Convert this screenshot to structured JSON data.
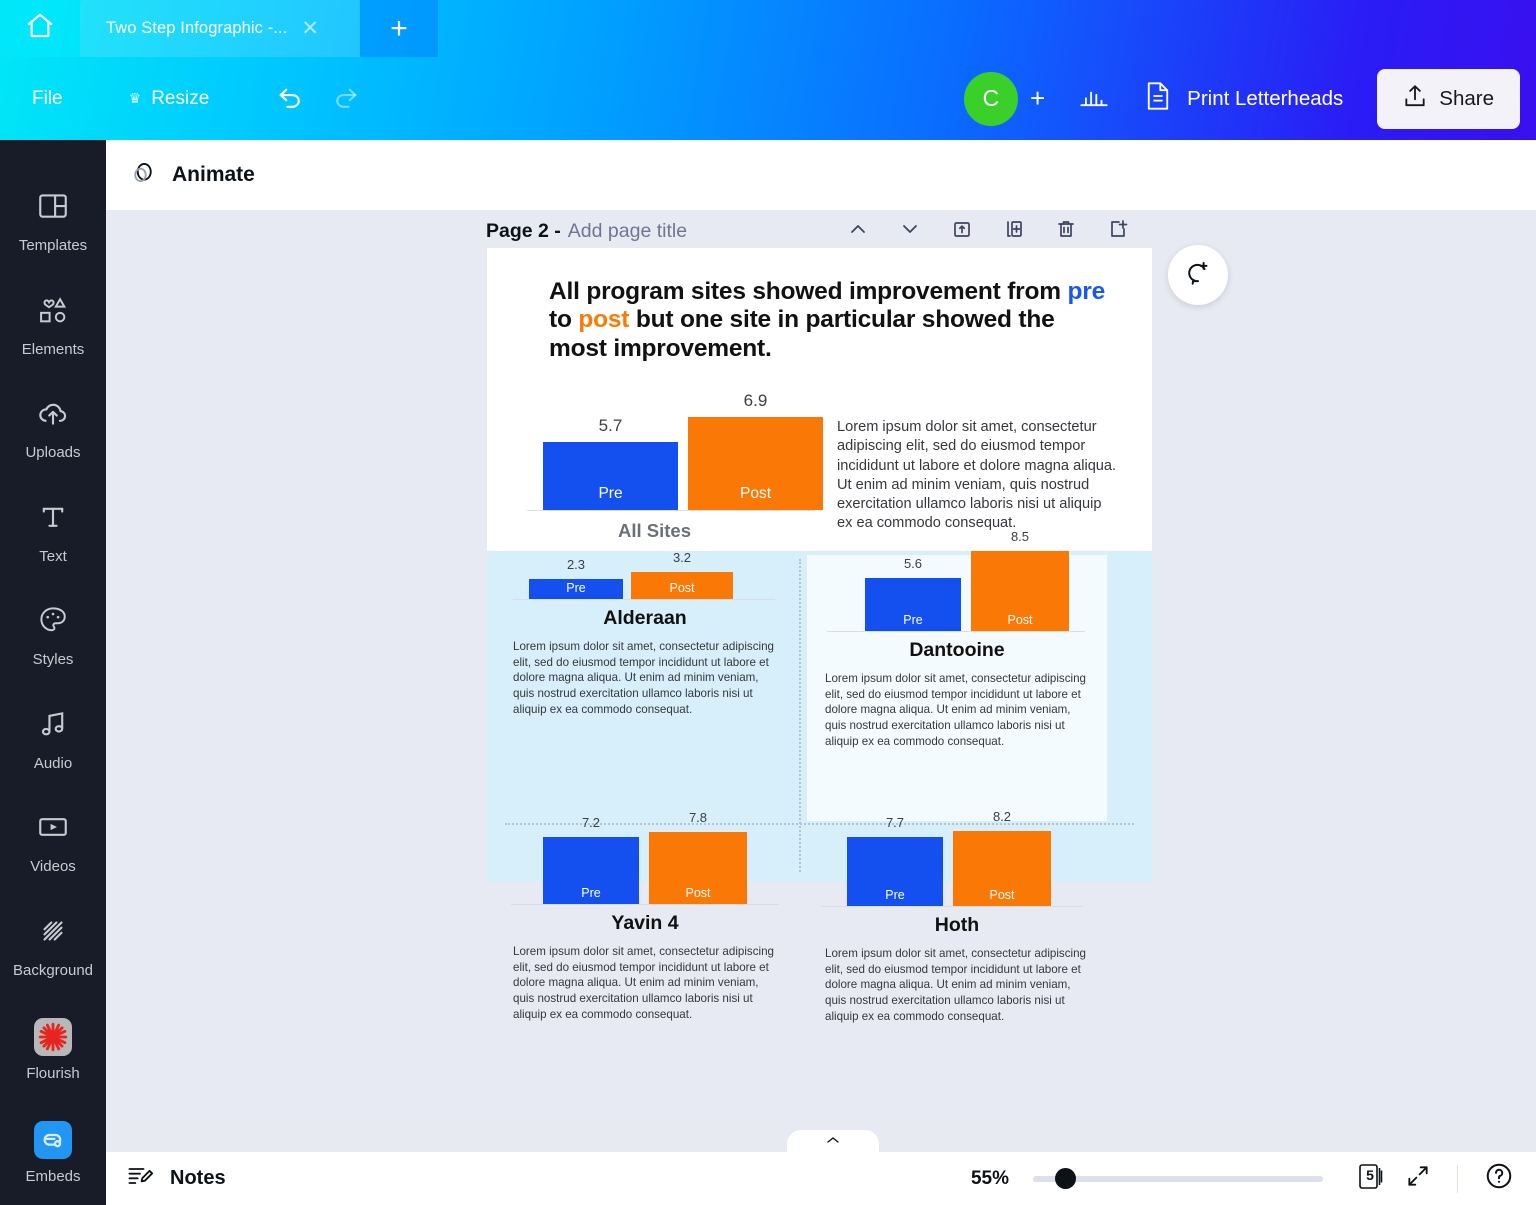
{
  "topbar": {
    "home_icon": "home-icon",
    "tab_title": "Two Step Infographic -...",
    "close_icon": "close-icon",
    "new_tab_icon": "plus-icon",
    "file_label": "File",
    "resize_label": "Resize",
    "crown_icon": "crown-icon",
    "undo_icon": "undo-icon",
    "redo_icon": "redo-icon",
    "avatar_initial": "C",
    "add_collaborator_icon": "plus-icon",
    "chart_icon": "bar-chart-icon",
    "print_label": "Print Letterheads",
    "print_icon": "document-icon",
    "share_label": "Share",
    "share_icon": "upload-icon",
    "accent_green": "#3ad029"
  },
  "sidebar": {
    "items": [
      {
        "label": "Templates",
        "icon": "templates-icon"
      },
      {
        "label": "Elements",
        "icon": "elements-icon"
      },
      {
        "label": "Uploads",
        "icon": "uploads-icon"
      },
      {
        "label": "Text",
        "icon": "text-icon"
      },
      {
        "label": "Styles",
        "icon": "styles-icon"
      },
      {
        "label": "Audio",
        "icon": "audio-icon"
      },
      {
        "label": "Videos",
        "icon": "videos-icon"
      },
      {
        "label": "Background",
        "icon": "background-icon"
      },
      {
        "label": "Flourish",
        "icon": "flourish-icon"
      },
      {
        "label": "Embeds",
        "icon": "embeds-icon"
      }
    ]
  },
  "toolbar": {
    "animate_label": "Animate",
    "animate_icon": "animate-icon"
  },
  "page_header": {
    "page_label": "Page 2 -",
    "title_placeholder": "Add page title",
    "tools": [
      {
        "icon": "chevron-up-icon",
        "name": "move-page-up"
      },
      {
        "icon": "chevron-down-icon",
        "name": "move-page-down"
      },
      {
        "icon": "lock-page-icon",
        "name": "lock-page"
      },
      {
        "icon": "duplicate-page-icon",
        "name": "duplicate-page"
      },
      {
        "icon": "trash-icon",
        "name": "delete-page"
      },
      {
        "icon": "add-page-icon",
        "name": "add-page"
      }
    ],
    "comment_icon": "add-comment-icon"
  },
  "design": {
    "headline": {
      "part1": "All program sites showed improvement from ",
      "pre": "pre",
      "mid": " to ",
      "post": "post",
      "part2": " but one site in particular showed the most improvement."
    },
    "colors": {
      "pre": "#1450F0",
      "post": "#FA7806",
      "panel_bg": "#D7EEFB",
      "highlight_bg": "#F3FBFF"
    },
    "body_text": "Lorem ipsum dolor sit amet, consectetur adipiscing elit, sed do eiusmod tempor incididunt ut labore et dolore magna aliqua. Ut enim ad minim veniam, quis nostrud exercitation ullamco laboris nisi ut aliquip ex ea commodo consequat."
  },
  "chart_data": [
    {
      "type": "bar",
      "title": "All Sites",
      "categories": [
        "Pre",
        "Post"
      ],
      "values": [
        5.7,
        6.9
      ],
      "colors": [
        "#1450F0",
        "#FA7806"
      ],
      "ylim": [
        0,
        10
      ],
      "xlabel": "",
      "ylabel": "",
      "grid": false,
      "legend": "none"
    },
    {
      "type": "bar",
      "title": "Alderaan",
      "categories": [
        "Pre",
        "Post"
      ],
      "values": [
        2.3,
        3.2
      ],
      "colors": [
        "#1450F0",
        "#FA7806"
      ],
      "ylim": [
        0,
        10
      ],
      "grid": false,
      "legend": "none"
    },
    {
      "type": "bar",
      "title": "Dantooine",
      "categories": [
        "Pre",
        "Post"
      ],
      "values": [
        5.6,
        8.5
      ],
      "colors": [
        "#1450F0",
        "#FA7806"
      ],
      "ylim": [
        0,
        10
      ],
      "grid": false,
      "legend": "none",
      "highlighted": true
    },
    {
      "type": "bar",
      "title": "Yavin 4",
      "categories": [
        "Pre",
        "Post"
      ],
      "values": [
        7.2,
        7.8
      ],
      "colors": [
        "#1450F0",
        "#FA7806"
      ],
      "ylim": [
        0,
        10
      ],
      "grid": false,
      "legend": "none"
    },
    {
      "type": "bar",
      "title": "Hoth",
      "categories": [
        "Pre",
        "Post"
      ],
      "values": [
        7.7,
        8.2
      ],
      "colors": [
        "#1450F0",
        "#FA7806"
      ],
      "ylim": [
        0,
        10
      ],
      "grid": false,
      "legend": "none"
    }
  ],
  "bottombar": {
    "notes_label": "Notes",
    "notes_icon": "notes-icon",
    "zoom_level": "55%",
    "page_count": "5",
    "expand_icon": "expand-icon",
    "help_icon": "help-icon",
    "collapse_icon": "chevron-up-icon"
  }
}
